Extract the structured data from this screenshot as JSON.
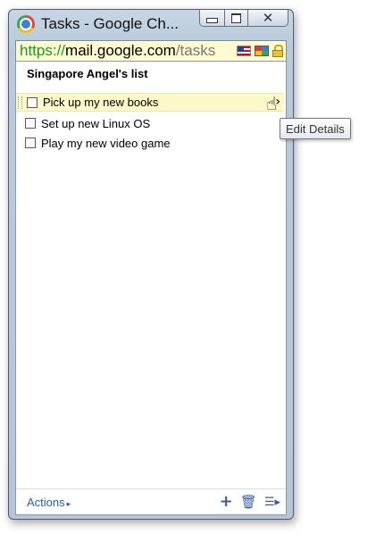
{
  "window": {
    "title": "Tasks - Google Ch...",
    "url": {
      "scheme": "https://",
      "host": "mail.google.com",
      "path": "/tasks"
    },
    "controls": {
      "minimize": "minimize",
      "maximize": "maximize",
      "close": "close"
    }
  },
  "list": {
    "title": "Singapore Angel's list",
    "tasks": [
      {
        "label": "Pick up my new books",
        "selected": true
      },
      {
        "label": "Set up new Linux OS",
        "selected": false
      },
      {
        "label": "Play my new video game",
        "selected": false
      }
    ],
    "edit_arrow": "›",
    "tooltip": "Edit Details"
  },
  "footer": {
    "actions_label": "Actions",
    "actions_arrow": "▸",
    "add_glyph": "+",
    "trash_glyph": "🗑",
    "menu_glyph": "☰▸"
  },
  "icons": {
    "app": "chrome-icon",
    "flag": "us-flag-icon",
    "extension": "extension-icon",
    "lock": "lock-icon"
  },
  "colors": {
    "omnibox_bg": "#fffbd0",
    "selected_row_bg": "#fdf8c8",
    "url_scheme": "#159a2c",
    "link": "#2a5db0"
  }
}
